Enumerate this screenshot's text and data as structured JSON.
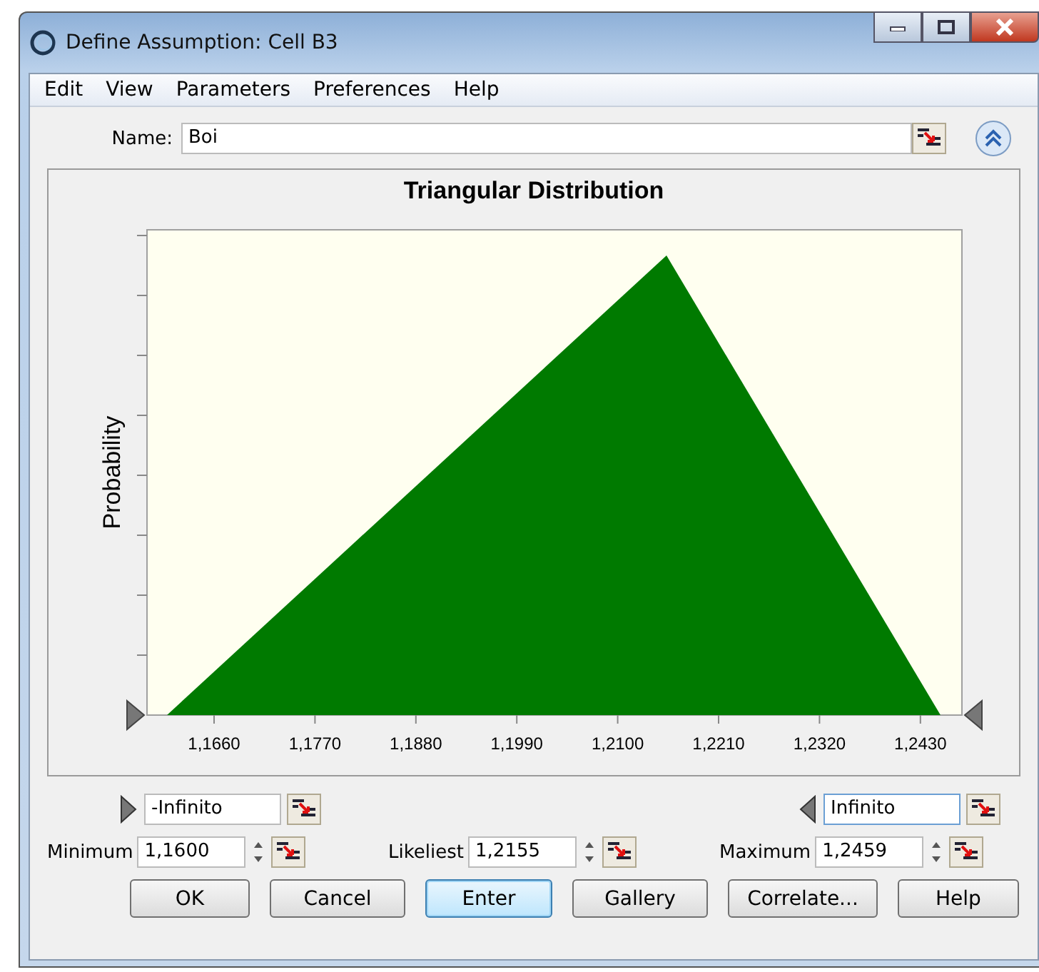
{
  "window": {
    "title": "Define Assumption: Cell B3"
  },
  "menu": [
    "Edit",
    "View",
    "Parameters",
    "Preferences",
    "Help"
  ],
  "name_field": {
    "label": "Name:",
    "value": "Boi"
  },
  "chart": {
    "title": "Triangular Distribution",
    "ylabel": "Probability",
    "x_tick_labels": [
      "1,1660",
      "1,1770",
      "1,1880",
      "1,1990",
      "1,2100",
      "1,2210",
      "1,2320",
      "1,2430"
    ]
  },
  "bounds": {
    "lower": "-Infinito",
    "upper": "Infinito"
  },
  "parameters": [
    {
      "label": "Minimum",
      "value": "1,1600"
    },
    {
      "label": "Likeliest",
      "value": "1,2155"
    },
    {
      "label": "Maximum",
      "value": "1,2459"
    }
  ],
  "buttons": [
    {
      "label": "OK",
      "selected": false
    },
    {
      "label": "Cancel",
      "selected": false
    },
    {
      "label": "Enter",
      "selected": true
    },
    {
      "label": "Gallery",
      "selected": false
    },
    {
      "label": "Correlate...",
      "selected": false
    },
    {
      "label": "Help",
      "selected": false
    }
  ]
}
